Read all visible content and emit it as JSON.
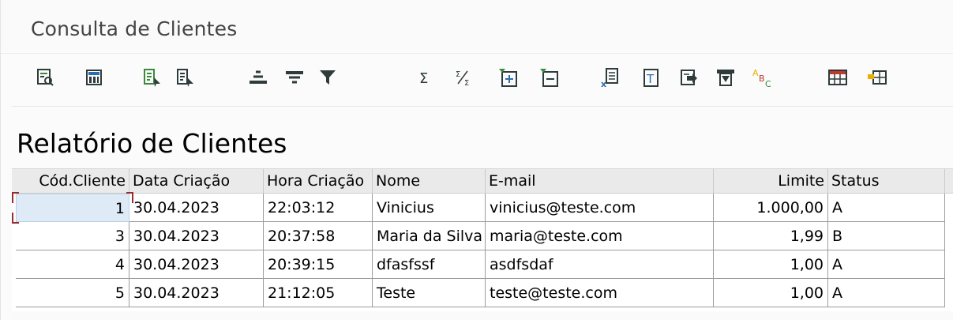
{
  "window": {
    "title": "Consulta de Clientes"
  },
  "toolbar": {
    "buttons": [
      {
        "name": "details-icon",
        "label": "Detalhes"
      },
      {
        "name": "calculator-icon",
        "label": "Calculadora"
      },
      {
        "name": "sort-ascending-icon",
        "label": "Ordem crescente"
      },
      {
        "name": "sort-descending-icon",
        "label": "Ordem decrescente"
      },
      {
        "name": "find-icon",
        "label": "Procurar"
      },
      {
        "name": "find-next-icon",
        "label": "Continuar procura"
      },
      {
        "name": "filter-icon",
        "label": "Filtro"
      },
      {
        "name": "sum-icon",
        "label": "Total"
      },
      {
        "name": "subtotal-icon",
        "label": "Subtotais"
      },
      {
        "name": "expand-icon",
        "label": "Expandir"
      },
      {
        "name": "collapse-icon",
        "label": "Comprimir"
      },
      {
        "name": "export-excel-icon",
        "label": "Planilha"
      },
      {
        "name": "text-processing-icon",
        "label": "Processamento de texto"
      },
      {
        "name": "local-file-icon",
        "label": "Arquivo local"
      },
      {
        "name": "print-preview-icon",
        "label": "Visualização de impressão"
      },
      {
        "name": "abc-analysis-icon",
        "label": "Análise ABC"
      },
      {
        "name": "change-layout-icon",
        "label": "Modificar layout"
      },
      {
        "name": "select-layout-icon",
        "label": "Selecionar layout"
      }
    ],
    "colors": {
      "green": "#3a8a3a",
      "dark": "#2f3b3b",
      "blue": "#2b6db3",
      "red": "#c0392b",
      "yellow": "#e8b100"
    }
  },
  "report": {
    "title": "Relatório de Clientes"
  },
  "table": {
    "columns": [
      {
        "key": "cod",
        "label": "Cód.Cliente",
        "align": "right"
      },
      {
        "key": "data",
        "label": "Data Criação",
        "align": "left"
      },
      {
        "key": "hora",
        "label": "Hora Criação",
        "align": "left"
      },
      {
        "key": "nome",
        "label": "Nome",
        "align": "left"
      },
      {
        "key": "email",
        "label": "E-mail",
        "align": "left"
      },
      {
        "key": "limite",
        "label": "Limite",
        "align": "right"
      },
      {
        "key": "status",
        "label": "Status",
        "align": "left"
      }
    ],
    "rows": [
      {
        "cod": "1",
        "data": "30.04.2023",
        "hora": "22:03:12",
        "nome": "Vinicius",
        "email": "vinicius@teste.com",
        "limite": "1.000,00",
        "status": "A"
      },
      {
        "cod": "3",
        "data": "30.04.2023",
        "hora": "20:37:58",
        "nome": "Maria da Silva",
        "email": "maria@teste.com",
        "limite": "1,99",
        "status": "B"
      },
      {
        "cod": "4",
        "data": "30.04.2023",
        "hora": "20:39:15",
        "nome": "dfasfssf",
        "email": "asdfsdaf",
        "limite": "1,00",
        "status": "A"
      },
      {
        "cod": "5",
        "data": "30.04.2023",
        "hora": "21:12:05",
        "nome": "Teste",
        "email": "teste@teste.com",
        "limite": "1,00",
        "status": "A"
      }
    ],
    "selected_row": 0,
    "selected_column": "cod"
  }
}
